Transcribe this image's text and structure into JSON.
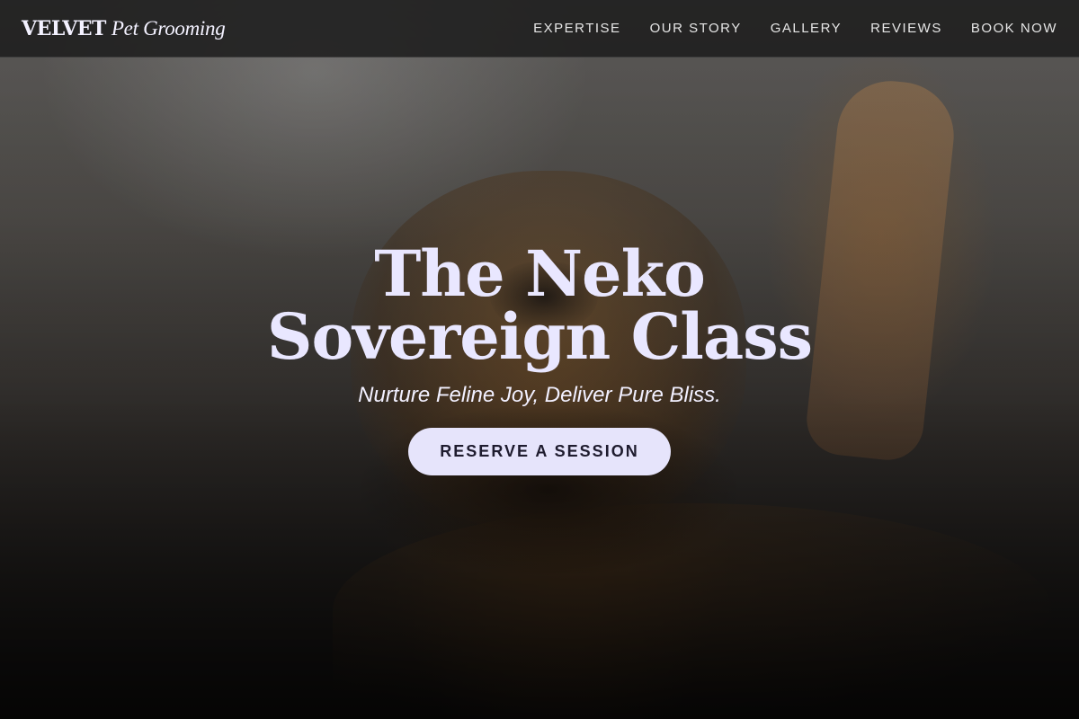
{
  "brand": {
    "name": "VELVET",
    "subtitle": "Pet Grooming"
  },
  "nav": {
    "items": [
      {
        "label": "EXPERTISE"
      },
      {
        "label": "OUR STORY"
      },
      {
        "label": "GALLERY"
      },
      {
        "label": "REVIEWS"
      },
      {
        "label": "BOOK NOW"
      }
    ]
  },
  "hero": {
    "title": "The Neko Sovereign Class",
    "tagline": "Nurture Feline Joy, Deliver Pure Bliss.",
    "cta_label": "RESERVE A SESSION"
  },
  "colors": {
    "accent": "#e6e4fb",
    "title_text": "#e9e7ff",
    "nav_background": "#1e1e1e"
  }
}
